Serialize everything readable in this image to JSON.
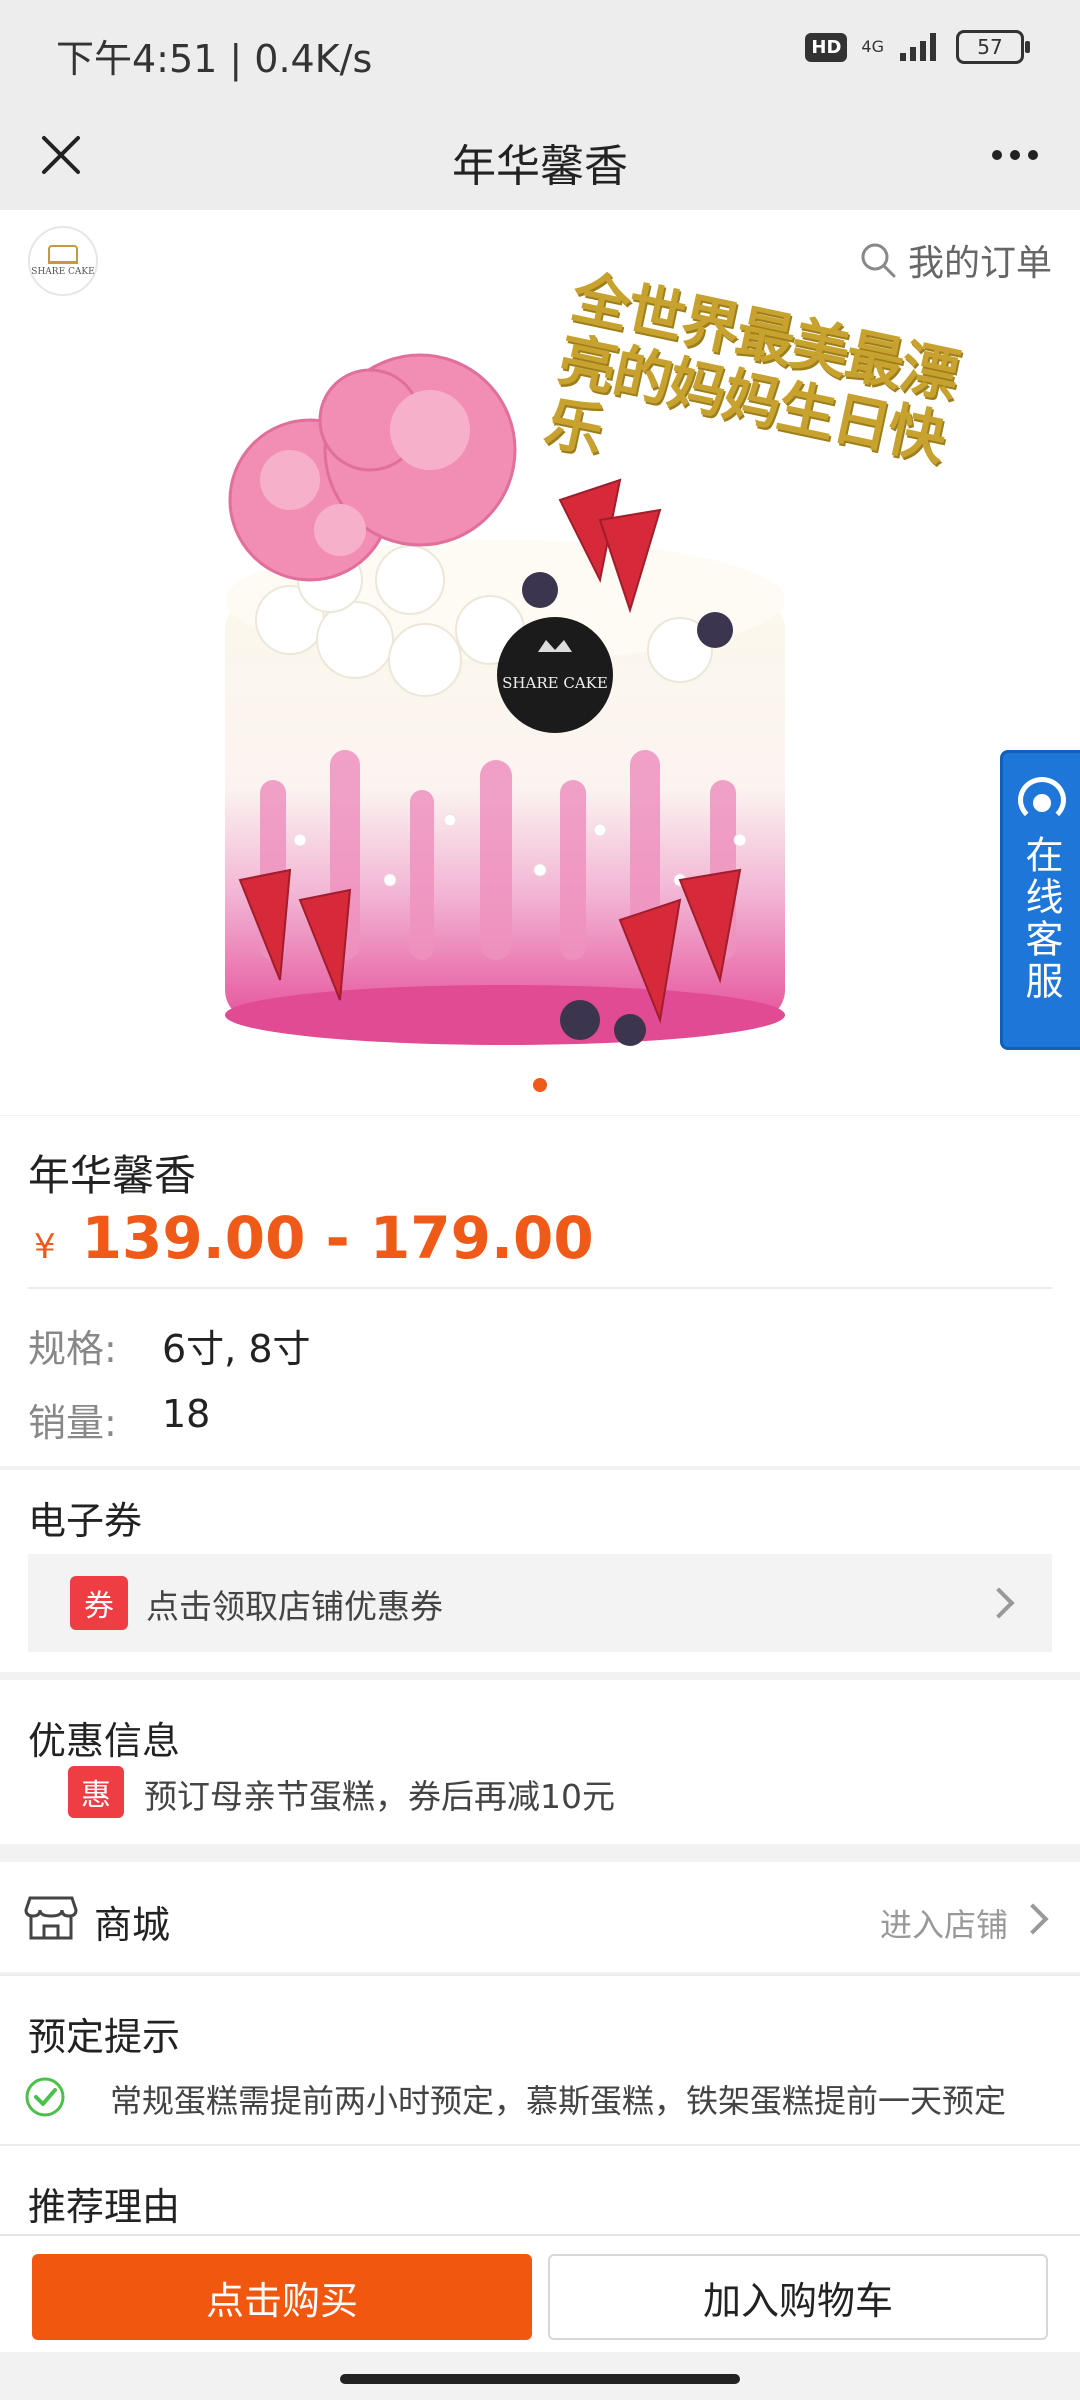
{
  "status_bar": {
    "time": "下午4:51 | 0.4K/s",
    "hd": "HD",
    "network": "4G",
    "battery": "57"
  },
  "titlebar": {
    "title": "年华馨香"
  },
  "hero": {
    "logo_text": "SHARE CAKE",
    "orders_label": "我的订单",
    "topper_text": "全世界最美最漂亮的妈妈生日快乐",
    "cake_brand": "SHARE CAKE"
  },
  "support": {
    "label": "在线客服"
  },
  "product": {
    "name": "年华馨香",
    "currency": "¥",
    "price_range": "139.00 - 179.00",
    "spec_key": "规格:",
    "spec_val": "6寸, 8寸",
    "sales_key": "销量:",
    "sales_val": "18"
  },
  "coupon": {
    "title": "电子券",
    "tag": "券",
    "text": "点击领取店铺优惠券"
  },
  "promo": {
    "title": "优惠信息",
    "tag": "惠",
    "text": "预订母亲节蛋糕，券后再减10元"
  },
  "mall": {
    "label": "商城",
    "enter": "进入店铺"
  },
  "notice": {
    "title": "预定提示",
    "text": "常规蛋糕需提前两小时预定，慕斯蛋糕，铁架蛋糕提前一天预定"
  },
  "reason": {
    "title": "推荐理由"
  },
  "actions": {
    "buy": "点击购买",
    "cart": "加入购物车"
  },
  "colors": {
    "accent": "#f25710",
    "price": "#f05a18",
    "tag_red": "#ef3d44",
    "support_blue": "#1e76d8"
  },
  "icons": [
    "close-icon",
    "more-icon",
    "search-icon",
    "chevron-right-icon",
    "shop-icon",
    "check-circle-icon",
    "headset-icon"
  ]
}
